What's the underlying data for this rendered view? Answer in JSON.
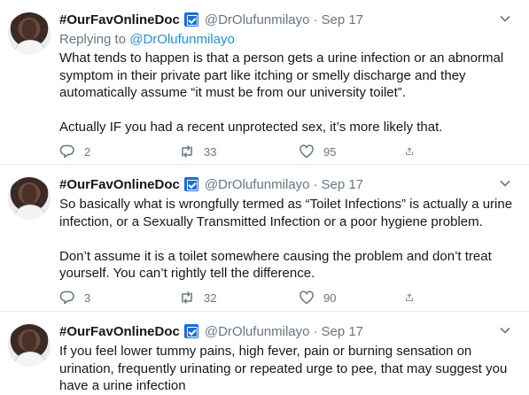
{
  "tweets": [
    {
      "display_name": "#OurFavOnlineDoc",
      "handle": "@DrOlufunmilayo",
      "date": "Sep 17",
      "replying_label": "Replying to",
      "replying_handle": "@DrOlufunmilayo",
      "paragraphs": [
        "What tends to happen is that a person gets a urine infection or an abnormal symptom in their private part like itching or smelly discharge and they automatically assume “it must be from our university toilet”.",
        "Actually IF you had a recent unprotected sex, it’s more likely that."
      ],
      "replies": "2",
      "retweets": "33",
      "likes": "95"
    },
    {
      "display_name": "#OurFavOnlineDoc",
      "handle": "@DrOlufunmilayo",
      "date": "Sep 17",
      "paragraphs": [
        "So basically what is wrongfully termed as “Toilet Infections” is actually a urine infection, or a Sexually Transmitted Infection or a poor hygiene problem.",
        "Don’t assume it is a toilet somewhere causing the problem and don’t treat yourself. You can’t rightly tell the difference."
      ],
      "replies": "3",
      "retweets": "32",
      "likes": "90"
    },
    {
      "display_name": "#OurFavOnlineDoc",
      "handle": "@DrOlufunmilayo",
      "date": "Sep 17",
      "paragraphs": [
        "If you feel lower tummy pains, high fever, pain or burning sensation on urination, frequently urinating or repeated urge to pee, that may suggest you have a urine infection"
      ]
    }
  ],
  "separator": "·",
  "icons": {
    "reply": "reply-icon",
    "retweet": "retweet-icon",
    "like": "heart-icon",
    "share": "share-icon",
    "more": "chevron-down-icon",
    "badge": "badge-icon"
  },
  "colors": {
    "text": "#14171a",
    "secondary": "#657786",
    "link": "#1b95e0",
    "divider": "#e6ecf0"
  }
}
